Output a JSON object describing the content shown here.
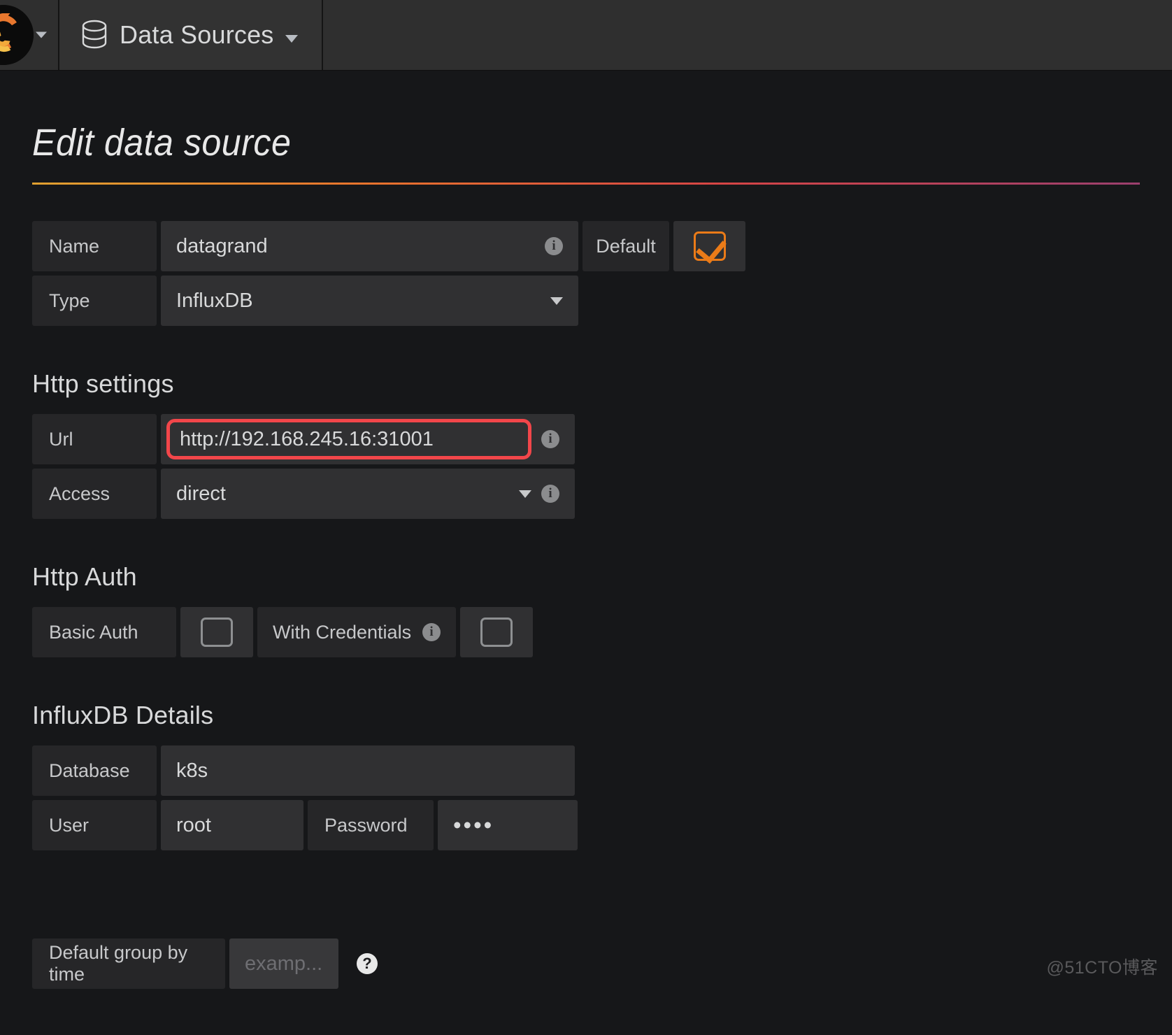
{
  "nav": {
    "logo_icon": "grafana-logo-icon",
    "logo_caret_icon": "chevron-down-icon",
    "data_sources_label": "Data Sources",
    "data_sources_icon": "database-icon",
    "data_sources_caret_icon": "chevron-down-icon"
  },
  "page": {
    "title": "Edit data source"
  },
  "general": {
    "name_label": "Name",
    "name_value": "datagrand",
    "name_info_icon": "info-icon",
    "default_label": "Default",
    "default_checked": true,
    "type_label": "Type",
    "type_value": "InfluxDB",
    "type_caret_icon": "chevron-down-icon"
  },
  "http_settings": {
    "heading": "Http settings",
    "url_label": "Url",
    "url_value": "http://192.168.245.16:31001",
    "url_info_icon": "info-icon",
    "url_highlight_color": "#f2464a",
    "access_label": "Access",
    "access_value": "direct",
    "access_caret_icon": "chevron-down-icon",
    "access_info_icon": "info-icon"
  },
  "http_auth": {
    "heading": "Http Auth",
    "basic_auth_label": "Basic Auth",
    "basic_auth_checked": false,
    "with_credentials_label": "With Credentials",
    "with_credentials_info_icon": "info-icon",
    "with_credentials_checked": false
  },
  "influxdb_details": {
    "heading": "InfluxDB Details",
    "database_label": "Database",
    "database_value": "k8s",
    "user_label": "User",
    "user_value": "root",
    "password_label": "Password",
    "password_value": "••••"
  },
  "group_by": {
    "label": "Default group by time",
    "placeholder": "examp...",
    "help_icon": "question-mark-icon",
    "help_glyph": "?"
  },
  "watermark": {
    "text": "@51CTO博客"
  },
  "colors": {
    "accent_orange": "#eb7b18",
    "background": "#161719",
    "panel": "#303032",
    "label_bg": "#262628",
    "annotation_red": "#f2464a"
  }
}
